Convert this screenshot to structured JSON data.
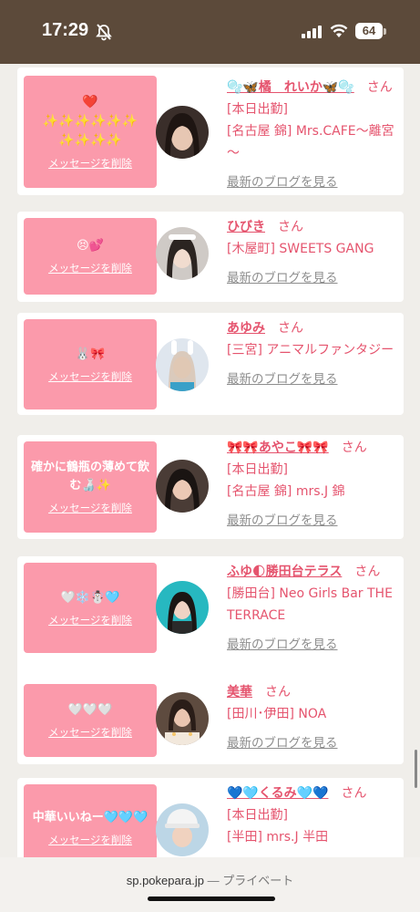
{
  "status_bar": {
    "time": "17:29",
    "battery": "64",
    "icons": [
      "bell-slash-icon",
      "signal-icon",
      "wifi-icon",
      "battery-icon"
    ]
  },
  "delete_label": "メッセージを削除",
  "blog_label": "最新のブログを見る",
  "honorific": "さん",
  "messages": [
    {
      "bubble": "❤️\n✨✨✨✨✨✨\n✨✨✨✨",
      "name": "🫧🦋橘　れいか🦋🫧",
      "details": [
        "[本日出勤]",
        "[名古屋 錦] Mrs.CAFE～離宮～"
      ]
    },
    {
      "bubble": "😣💕",
      "name": "ひびき",
      "details": [
        "[木屋町] SWEETS GANG"
      ]
    },
    {
      "bubble": "🐰🎀",
      "name": "あゆみ",
      "details": [
        "[三宮] アニマルファンタジー"
      ]
    },
    {
      "bubble": "確かに鶴瓶の薄めて飲む🍶✨",
      "name": "🎀🎀あやこ🎀🎀",
      "details": [
        "[本日出勤]",
        "[名古屋 錦] mrs.J 錦"
      ]
    },
    {
      "bubble": "🤍❄️☃️🩵",
      "name": "ふゆ🌓勝田台テラス",
      "details": [
        "[勝田台] Neo Girls Bar THE TERRACE"
      ]
    },
    {
      "bubble": "🤍🤍🤍",
      "name": "美華",
      "details": [
        "[田川･伊田] NOA"
      ]
    },
    {
      "bubble": "中華いいねー🩵🩵🩵",
      "name": "💙🩵くるみ🩵💙",
      "details": [
        "[本日出勤]",
        "[半田] mrs.J 半田"
      ]
    }
  ],
  "url_bar": {
    "domain": "sp.pokepara.jp",
    "separator": " — ",
    "mode": "プライベート"
  },
  "colors": {
    "status_bg": "#5c4a3a",
    "bubble": "#fb9aab",
    "name": "#e5546e",
    "link": "#8e8e8e",
    "page_bg": "#f0eeea"
  }
}
